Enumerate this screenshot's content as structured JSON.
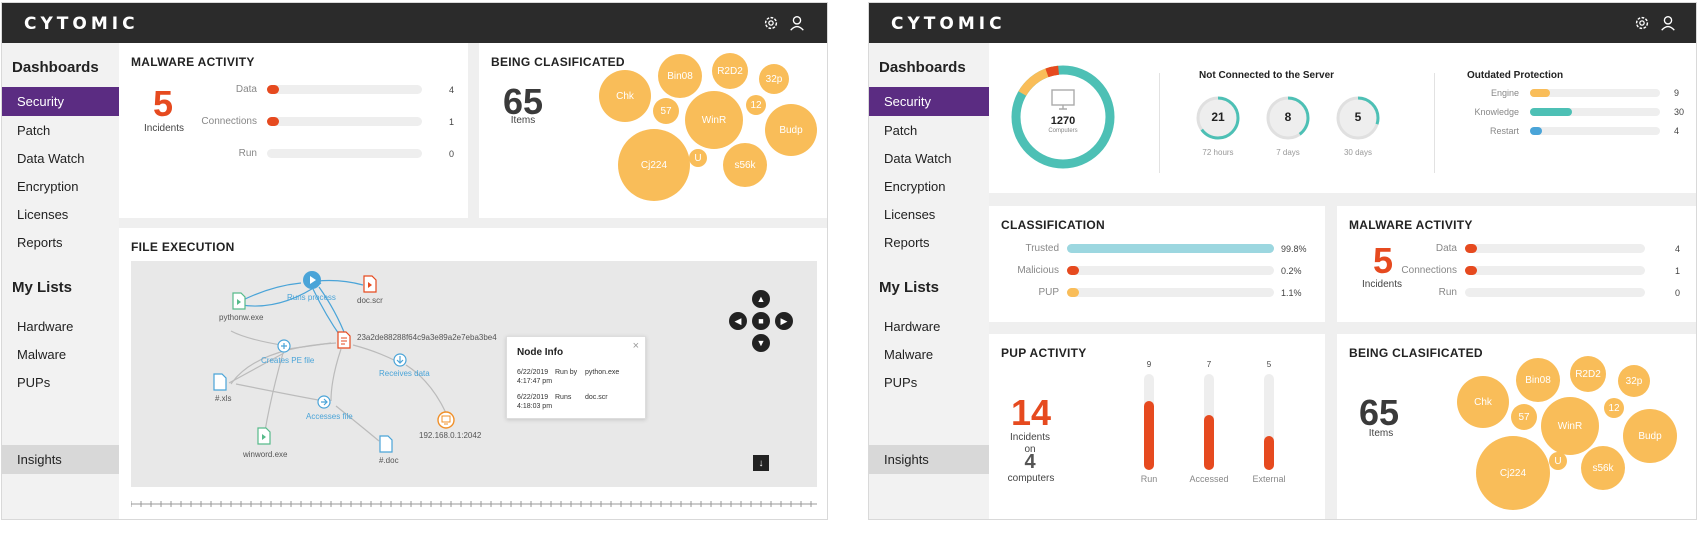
{
  "colors": {
    "accent": "#5b2c82",
    "danger": "#e64a1f",
    "bubble": "#f9bd59",
    "teal": "#4dc0b5",
    "blue": "#4aa4d8",
    "topbar": "#2b2b2b"
  },
  "app": {
    "logo": "CYTOMIC"
  },
  "sidebar": {
    "dashboards_heading": "Dashboards",
    "dashboards": [
      "Security",
      "Patch",
      "Data Watch",
      "Encryption",
      "Licenses",
      "Reports"
    ],
    "active": "Security",
    "lists_heading": "My Lists",
    "lists": [
      "Hardware",
      "Malware",
      "PUPs"
    ],
    "insights": "Insights"
  },
  "malware_activity": {
    "title": "MALWARE ACTIVITY",
    "incidents": "5",
    "incidents_label": "Incidents",
    "rows": [
      {
        "label": "Data",
        "value": "4",
        "fraction": 0.06
      },
      {
        "label": "Connections",
        "value": "1",
        "fraction": 0.06
      },
      {
        "label": "Run",
        "value": "0",
        "fraction": 0
      }
    ]
  },
  "being_classificated": {
    "title": "BEING CLASIFICATED",
    "count": "65",
    "count_label": "Items",
    "bubbles": [
      "Chk",
      "Bin08",
      "R2D2",
      "32p",
      "57",
      "WinR",
      "12",
      "Budp",
      "Cj224",
      "U",
      "s56k"
    ]
  },
  "file_execution": {
    "title": "FILE EXECUTION",
    "nodes": {
      "pythonw": "pythonw.exe",
      "runs_process": "Runs process",
      "docscr": "doc.scr",
      "hash": "23a2de88288f64c9a3e89a2e7eba3be4",
      "creates_pe": "Creates PE file",
      "receives_data": "Receives data",
      "xls": "#.xls",
      "accesses_file": "Accesses file",
      "ip": "192.168.0.1:2042",
      "winword": "winword.exe",
      "doc": "#.doc"
    },
    "node_info": {
      "title": "Node Info",
      "rows": [
        {
          "date": "6/22/2019",
          "time": "4:17:47 pm",
          "key": "Run by",
          "value": "python.exe"
        },
        {
          "date": "6/22/2019",
          "time": "4:18:03 pm",
          "key": "Runs",
          "value": "doc.scr"
        }
      ]
    }
  },
  "computers": {
    "count": "1270",
    "label": "Computers"
  },
  "not_connected": {
    "title": "Not Connected to the Server",
    "items": [
      {
        "value": "21",
        "label": "72 hours",
        "fraction": 0.65
      },
      {
        "value": "8",
        "label": "7 days",
        "fraction": 0.4
      },
      {
        "value": "5",
        "label": "30 days",
        "fraction": 0.3
      }
    ]
  },
  "outdated": {
    "title": "Outdated Protection",
    "rows": [
      {
        "label": "Engine",
        "value": "9",
        "fraction": 0.15,
        "color": "#f9bd59"
      },
      {
        "label": "Knowledge",
        "value": "30",
        "fraction": 0.32,
        "color": "#4dc0b5"
      },
      {
        "label": "Restart",
        "value": "4",
        "fraction": 0.08,
        "color": "#4aa4d8"
      }
    ]
  },
  "classification": {
    "title": "CLASSIFICATION",
    "rows": [
      {
        "label": "Trusted",
        "value": "99.8%",
        "fraction": 0.998,
        "color": "#9cd7e0"
      },
      {
        "label": "Malicious",
        "value": "0.2%",
        "fraction": 0.04,
        "color": "#e64a1f"
      },
      {
        "label": "PUP",
        "value": "1.1%",
        "fraction": 0.06,
        "color": "#f9bd59"
      }
    ]
  },
  "pup_activity": {
    "title": "PUP ACTIVITY",
    "incidents": "14",
    "incidents_label": "Incidents",
    "on": "on",
    "computers": "4",
    "computers_label": "computers",
    "bars": [
      {
        "label": "Run",
        "value": "9",
        "fraction": 0.72
      },
      {
        "label": "Accessed",
        "value": "7",
        "fraction": 0.57
      },
      {
        "label": "External",
        "value": "5",
        "fraction": 0.35
      }
    ]
  }
}
